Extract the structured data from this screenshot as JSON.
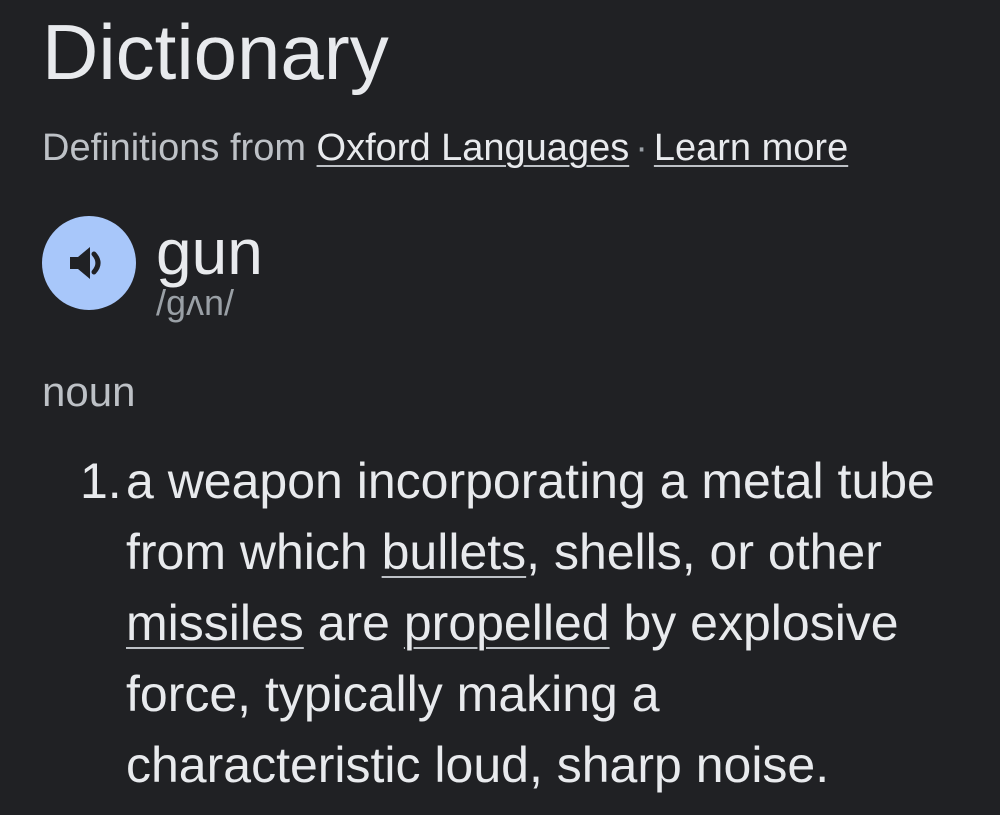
{
  "header": {
    "title": "Dictionary",
    "source_prefix": "Definitions from ",
    "source_link": "Oxford Languages",
    "separator": "·",
    "learn_more": "Learn more"
  },
  "entry": {
    "word": "gun",
    "phonetic": "/ɡʌn/",
    "speaker_icon": "volume-icon",
    "part_of_speech": "noun"
  },
  "definitions": [
    {
      "number": "1.",
      "segments": [
        {
          "text": "a weapon incorporating a metal tube from which ",
          "link": false
        },
        {
          "text": "bullets",
          "link": true
        },
        {
          "text": ", shells, or other ",
          "link": false
        },
        {
          "text": "missiles",
          "link": true
        },
        {
          "text": " are ",
          "link": false
        },
        {
          "text": "propelled",
          "link": true
        },
        {
          "text": " by explosive force, typically making a characteristic loud, sharp noise.",
          "link": false
        }
      ]
    }
  ],
  "colors": {
    "background": "#202124",
    "speaker_button": "#a8c7fa",
    "primary_text": "#e8eaed",
    "secondary_text": "#bdc1c6"
  }
}
